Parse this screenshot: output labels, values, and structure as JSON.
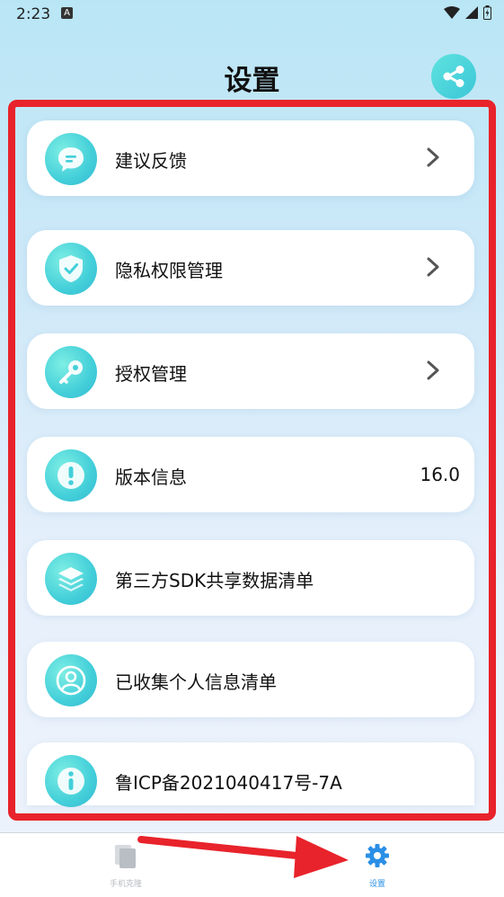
{
  "status": {
    "time": "2:23",
    "notification_icon": "A"
  },
  "header": {
    "title": "设置",
    "share_icon": "share-icon"
  },
  "items": [
    {
      "label": "建议反馈",
      "icon": "chat-bubble-icon",
      "trailing": "chevron"
    },
    {
      "label": "隐私权限管理",
      "icon": "shield-check-icon",
      "trailing": "chevron"
    },
    {
      "label": "授权管理",
      "icon": "key-icon",
      "trailing": "chevron"
    },
    {
      "label": "版本信息",
      "icon": "exclamation-icon",
      "value": "16.0"
    },
    {
      "label": "第三方SDK共享数据清单",
      "icon": "layers-icon"
    },
    {
      "label": "已收集个人信息清单",
      "icon": "person-icon"
    },
    {
      "label": "鲁ICP备2021040417号-7A",
      "icon": "info-icon"
    }
  ],
  "nav": [
    {
      "label": "手机克隆",
      "active": false
    },
    {
      "label": "设置",
      "active": true
    }
  ],
  "colors": {
    "accent": "#3cc6d8",
    "highlight_red": "#e8232b",
    "active_tab": "#2b8fe6"
  }
}
